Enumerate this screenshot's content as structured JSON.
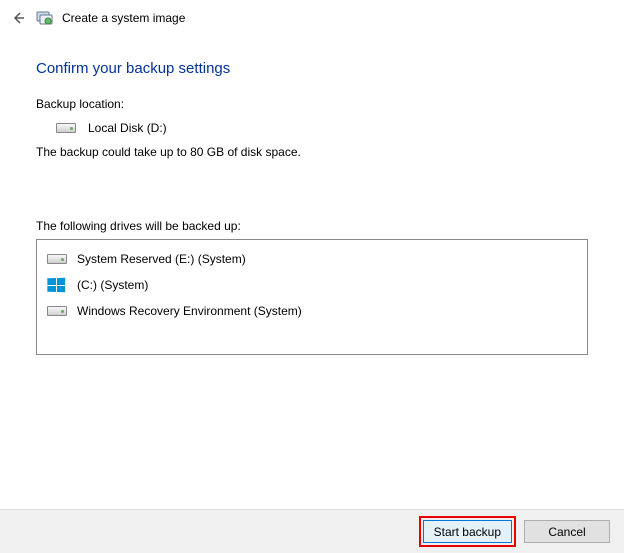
{
  "window": {
    "title": "Create a system image"
  },
  "heading": "Confirm your backup settings",
  "backup_location_label": "Backup location:",
  "destination": {
    "name": "Local Disk (D:)"
  },
  "size_note": "The backup could take up to 80 GB of disk space.",
  "drives_label": "The following drives will be backed up:",
  "drives": [
    {
      "label": "System Reserved (E:) (System)",
      "icon": "hdd"
    },
    {
      "label": "(C:) (System)",
      "icon": "windows"
    },
    {
      "label": "Windows Recovery Environment (System)",
      "icon": "hdd"
    }
  ],
  "buttons": {
    "start": "Start backup",
    "cancel": "Cancel"
  }
}
